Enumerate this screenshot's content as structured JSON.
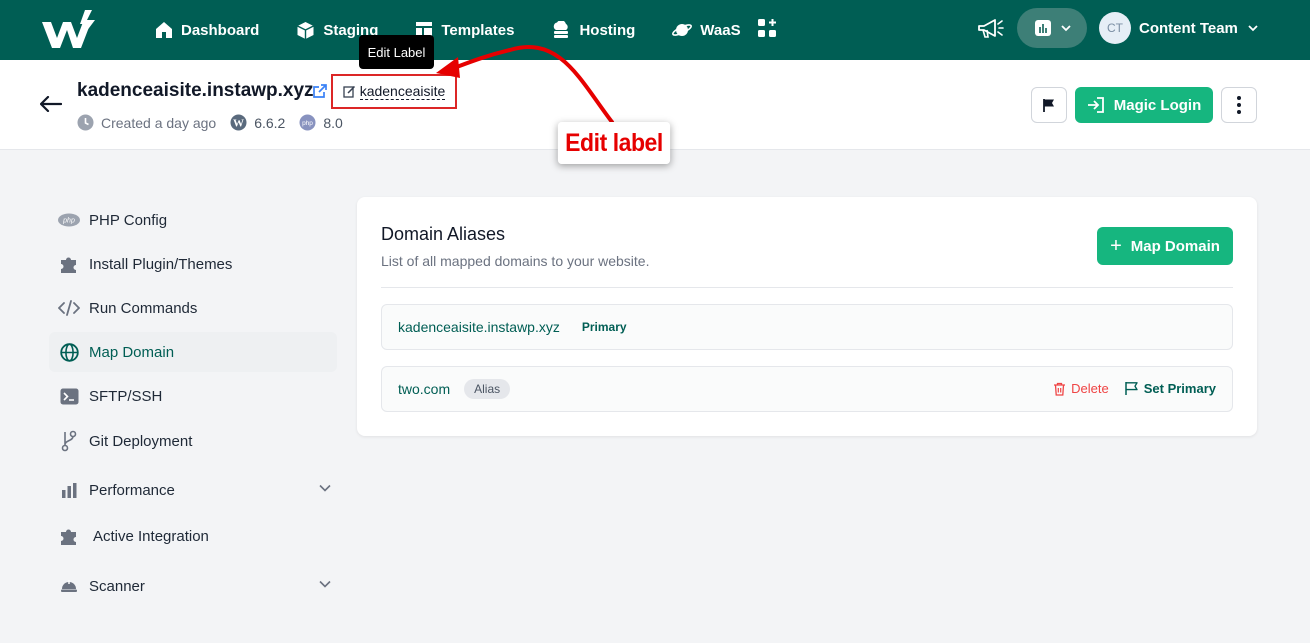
{
  "nav": {
    "items": [
      {
        "label": "Dashboard",
        "icon": "home-icon"
      },
      {
        "label": "Staging",
        "icon": "cube-icon"
      },
      {
        "label": "Templates",
        "icon": "template-icon"
      },
      {
        "label": "Hosting",
        "icon": "cloud-server-icon"
      },
      {
        "label": "WaaS",
        "icon": "planet-icon"
      }
    ],
    "apps_icon": "apps-grid-icon",
    "announcement_icon": "megaphone-icon",
    "theme_icon": "chart-icon",
    "user": {
      "initials": "CT",
      "name": "Content Team"
    }
  },
  "site": {
    "title": "kadenceaisite.instawp.xyz",
    "label": "kadenceaisite",
    "tooltip": "Edit Label",
    "created": "Created a day ago",
    "wp_version": "6.6.2",
    "php_version": "8.0",
    "magic_login_label": "Magic Login"
  },
  "annotation": {
    "text": "Edit label",
    "color": "#e60000"
  },
  "sidebar": {
    "items": [
      {
        "label": "PHP Config",
        "icon": "php-icon"
      },
      {
        "label": "Install Plugin/Themes",
        "icon": "puzzle-icon"
      },
      {
        "label": "Run Commands",
        "icon": "code-icon"
      },
      {
        "label": "Map Domain",
        "icon": "globe-icon",
        "active": true
      },
      {
        "label": "SFTP/SSH",
        "icon": "terminal-icon"
      },
      {
        "label": "Git Deployment",
        "icon": "git-branch-icon"
      },
      {
        "label": "Performance",
        "icon": "bar-chart-icon",
        "expandable": true
      },
      {
        "label": "Active Integration",
        "icon": "puzzle-icon"
      },
      {
        "label": "Scanner",
        "icon": "helmet-icon",
        "expandable": true
      }
    ]
  },
  "domains": {
    "title": "Domain Aliases",
    "subtitle": "List of all mapped domains to your website.",
    "map_button": "Map Domain",
    "rows": [
      {
        "name": "kadenceaisite.instawp.xyz",
        "badge": "Primary"
      },
      {
        "name": "two.com",
        "badge": "Alias",
        "delete_label": "Delete",
        "set_primary_label": "Set Primary"
      }
    ]
  },
  "colors": {
    "brand": "#005e54",
    "accent": "#16b67f",
    "danger": "#ef4444"
  }
}
